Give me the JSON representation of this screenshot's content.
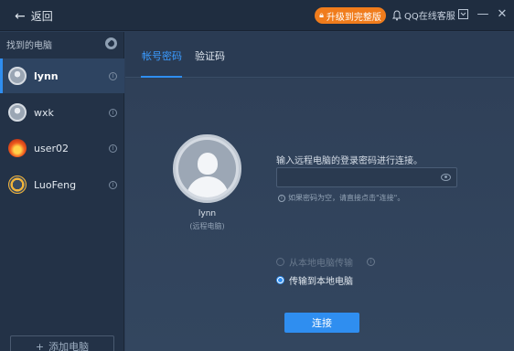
{
  "titlebar": {
    "back_label": "返回",
    "upgrade_label": "升级到完整版",
    "qq_label": "QQ在线客服",
    "icons": [
      "back-arrow-icon",
      "lock-icon",
      "bell-icon",
      "dropdown-icon",
      "minimize-icon",
      "close-icon"
    ]
  },
  "sidebar": {
    "header": "找到的电脑",
    "devices": [
      {
        "name": "lynn",
        "avatar": "gray-person"
      },
      {
        "name": "wxk",
        "avatar": "gray-person"
      },
      {
        "name": "user02",
        "avatar": "flame"
      },
      {
        "name": "LuoFeng",
        "avatar": "orange-ring"
      }
    ],
    "add_label": "添加电脑"
  },
  "main": {
    "tabs": [
      {
        "label": "帐号密码"
      },
      {
        "label": "验证码"
      }
    ],
    "remote": {
      "name": "lynn",
      "subtitle": "(远程电脑)"
    },
    "prompt": "输入远程电脑的登录密码进行连接。",
    "password": {
      "value": "",
      "placeholder": ""
    },
    "hint": "如果密码为空，请直接点击\"连接\"。",
    "options": [
      {
        "label": "从本地电脑传输",
        "state": "disabled"
      },
      {
        "label": "传输到本地电脑",
        "state": "checked"
      }
    ],
    "connect_label": "连接"
  },
  "colors": {
    "accent": "#2f8ef0",
    "upgrade": "#f07c1c",
    "titlebar": "#1f2d40",
    "sidebar": "#233247",
    "main": "#2c3e57"
  }
}
